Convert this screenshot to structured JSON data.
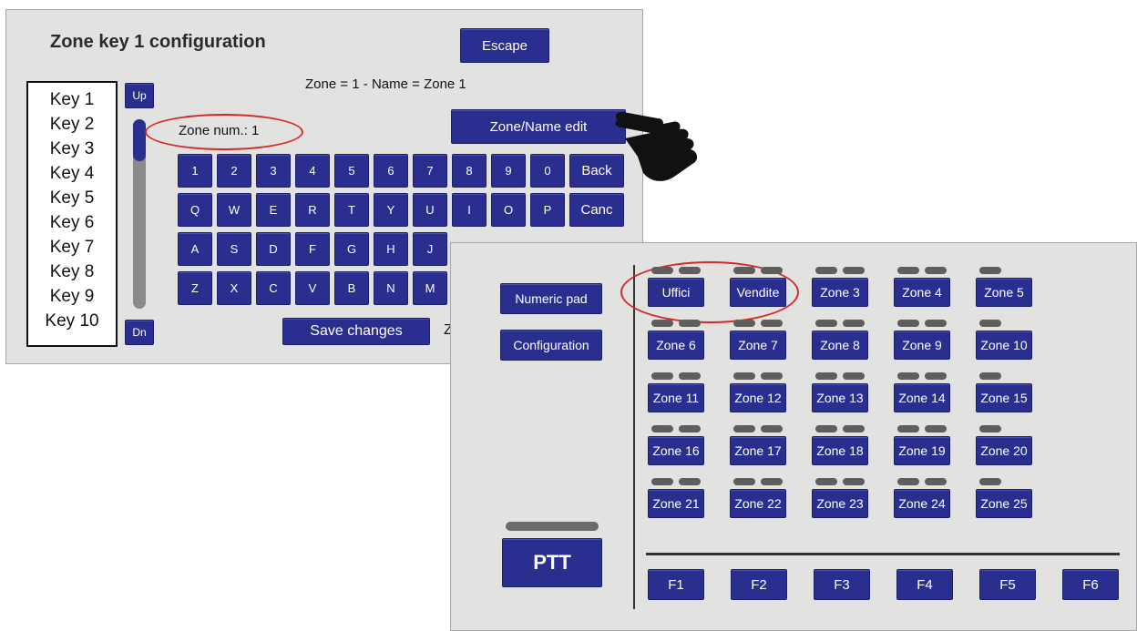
{
  "config_screen": {
    "title": "Zone key 1 configuration",
    "escape_label": "Escape",
    "zone_info": "Zone = 1  -  Name = Zone 1",
    "keys": [
      "Key 1",
      "Key 2",
      "Key 3",
      "Key 4",
      "Key 5",
      "Key 6",
      "Key 7",
      "Key 8",
      "Key 9",
      "Key 10"
    ],
    "up_label": "Up",
    "dn_label": "Dn",
    "zone_num_label": "Zone num.:  1",
    "zone_name_edit_label": "Zone/Name edit",
    "keyboard": {
      "row1": [
        "1",
        "2",
        "3",
        "4",
        "5",
        "6",
        "7",
        "8",
        "9",
        "0",
        "Back"
      ],
      "row2": [
        "Q",
        "W",
        "E",
        "R",
        "T",
        "Y",
        "U",
        "I",
        "O",
        "P",
        "Canc"
      ],
      "row3": [
        "A",
        "S",
        "D",
        "F",
        "G",
        "H",
        "J"
      ],
      "row4": [
        "Z",
        "X",
        "C",
        "V",
        "B",
        "N",
        "M"
      ]
    },
    "save_label": "Save changes",
    "save_suffix": "Z"
  },
  "zone_screen": {
    "numeric_pad_label": "Numeric pad",
    "configuration_label": "Configuration",
    "ptt_label": "PTT",
    "zones": [
      [
        "Uffici",
        "Vendite",
        "Zone 3",
        "Zone 4",
        "Zone 5"
      ],
      [
        "Zone 6",
        "Zone 7",
        "Zone 8",
        "Zone 9",
        "Zone 10"
      ],
      [
        "Zone 11",
        "Zone 12",
        "Zone 13",
        "Zone 14",
        "Zone 15"
      ],
      [
        "Zone 16",
        "Zone 17",
        "Zone 18",
        "Zone 19",
        "Zone 20"
      ],
      [
        "Zone 21",
        "Zone 22",
        "Zone 23",
        "Zone 24",
        "Zone 25"
      ]
    ],
    "function_keys": [
      "F1",
      "F2",
      "F3",
      "F4",
      "F5",
      "F6"
    ]
  },
  "colors": {
    "button_bg": "#2a2f8f",
    "button_text": "#ffffff",
    "panel_bg": "#e2e2e0",
    "highlight_ellipse": "#d42a2a",
    "led": "#5e5e5e"
  },
  "icons": {
    "pointer": "pointing-hand-icon"
  }
}
